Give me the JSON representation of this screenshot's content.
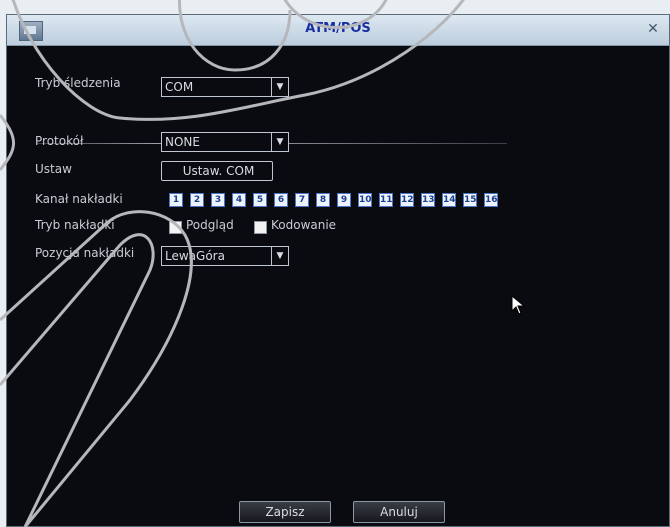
{
  "window": {
    "title": "ATM/POS",
    "icon": "dvr-window-icon",
    "close_icon": "close-icon"
  },
  "form": {
    "connection_mode": {
      "label": "Tryb śledzenia",
      "value": "COM"
    },
    "protocol": {
      "label": "Protokół",
      "value": "NONE"
    },
    "device": {
      "label": "Ustaw",
      "value": "Ustaw. COM"
    },
    "overlay_channel": {
      "label": "Kanał nakładki",
      "channels": [
        "1",
        "2",
        "3",
        "4",
        "5",
        "6",
        "7",
        "8",
        "9",
        "10",
        "11",
        "12",
        "13",
        "14",
        "15",
        "16"
      ]
    },
    "overlay_mode": {
      "label": "Tryb nakładki",
      "options": [
        {
          "label": "Podgląd",
          "checked": false
        },
        {
          "label": "Kodowanie",
          "checked": false
        }
      ]
    },
    "overlay_position": {
      "label": "Pozycja nakładki",
      "value": "LewaGóra"
    }
  },
  "buttons": {
    "save": "Zapisz",
    "cancel": "Anuluj"
  },
  "colors": {
    "background": "#0a0b10",
    "title_text": "#1a2ea0",
    "channel_chip": "#4a74c8",
    "overlay_curves": "#b5b7bb"
  }
}
